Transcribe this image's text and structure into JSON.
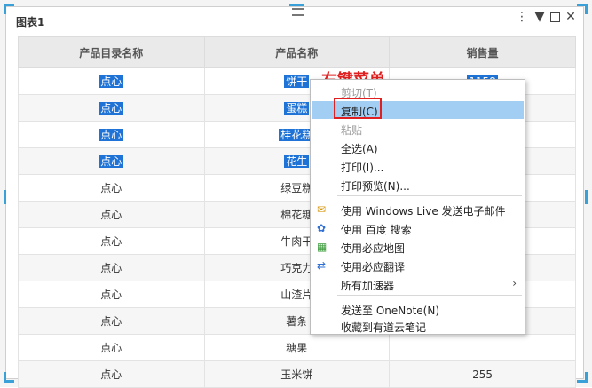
{
  "widget": {
    "title": "图表1"
  },
  "table": {
    "headers": [
      "产品目录名称",
      "产品名称",
      "销售量"
    ],
    "rows": [
      [
        "点心",
        "饼干",
        "1158"
      ],
      [
        "点心",
        "蛋糕",
        ""
      ],
      [
        "点心",
        "桂花糕",
        ""
      ],
      [
        "点心",
        "花生",
        ""
      ],
      [
        "点心",
        "绿豆糕",
        ""
      ],
      [
        "点心",
        "棉花糖",
        ""
      ],
      [
        "点心",
        "牛肉干",
        ""
      ],
      [
        "点心",
        "巧克力",
        ""
      ],
      [
        "点心",
        "山渣片",
        ""
      ],
      [
        "点心",
        "薯条",
        ""
      ],
      [
        "点心",
        "糖果",
        ""
      ],
      [
        "点心",
        "玉米饼",
        "255"
      ]
    ]
  },
  "annotation": {
    "text": "右键菜单"
  },
  "context_menu": {
    "items": [
      {
        "label": "剪切(T)",
        "disabled": true
      },
      {
        "label": "复制(C)",
        "highlight": true
      },
      {
        "label": "粘贴",
        "disabled": true
      },
      {
        "label": "全选(A)"
      },
      {
        "label": "打印(I)..."
      },
      {
        "label": "打印预览(N)..."
      },
      {
        "label": "使用 Windows Live 发送电子邮件",
        "icon": "mail-icon"
      },
      {
        "label": "使用 百度 搜索",
        "icon": "baidu-paw-icon"
      },
      {
        "label": "使用必应地图",
        "icon": "map-icon"
      },
      {
        "label": "使用必应翻译",
        "icon": "translate-icon"
      },
      {
        "label": "所有加速器",
        "submenu": true
      },
      {
        "label": "发送至 OneNote(N)"
      },
      {
        "label": "收藏到有道云笔记"
      }
    ]
  },
  "colors": {
    "selection": "#1f73d6",
    "menu_highlight": "#a3cef4",
    "annotation": "#e02020",
    "handle": "#3aa0d8"
  }
}
